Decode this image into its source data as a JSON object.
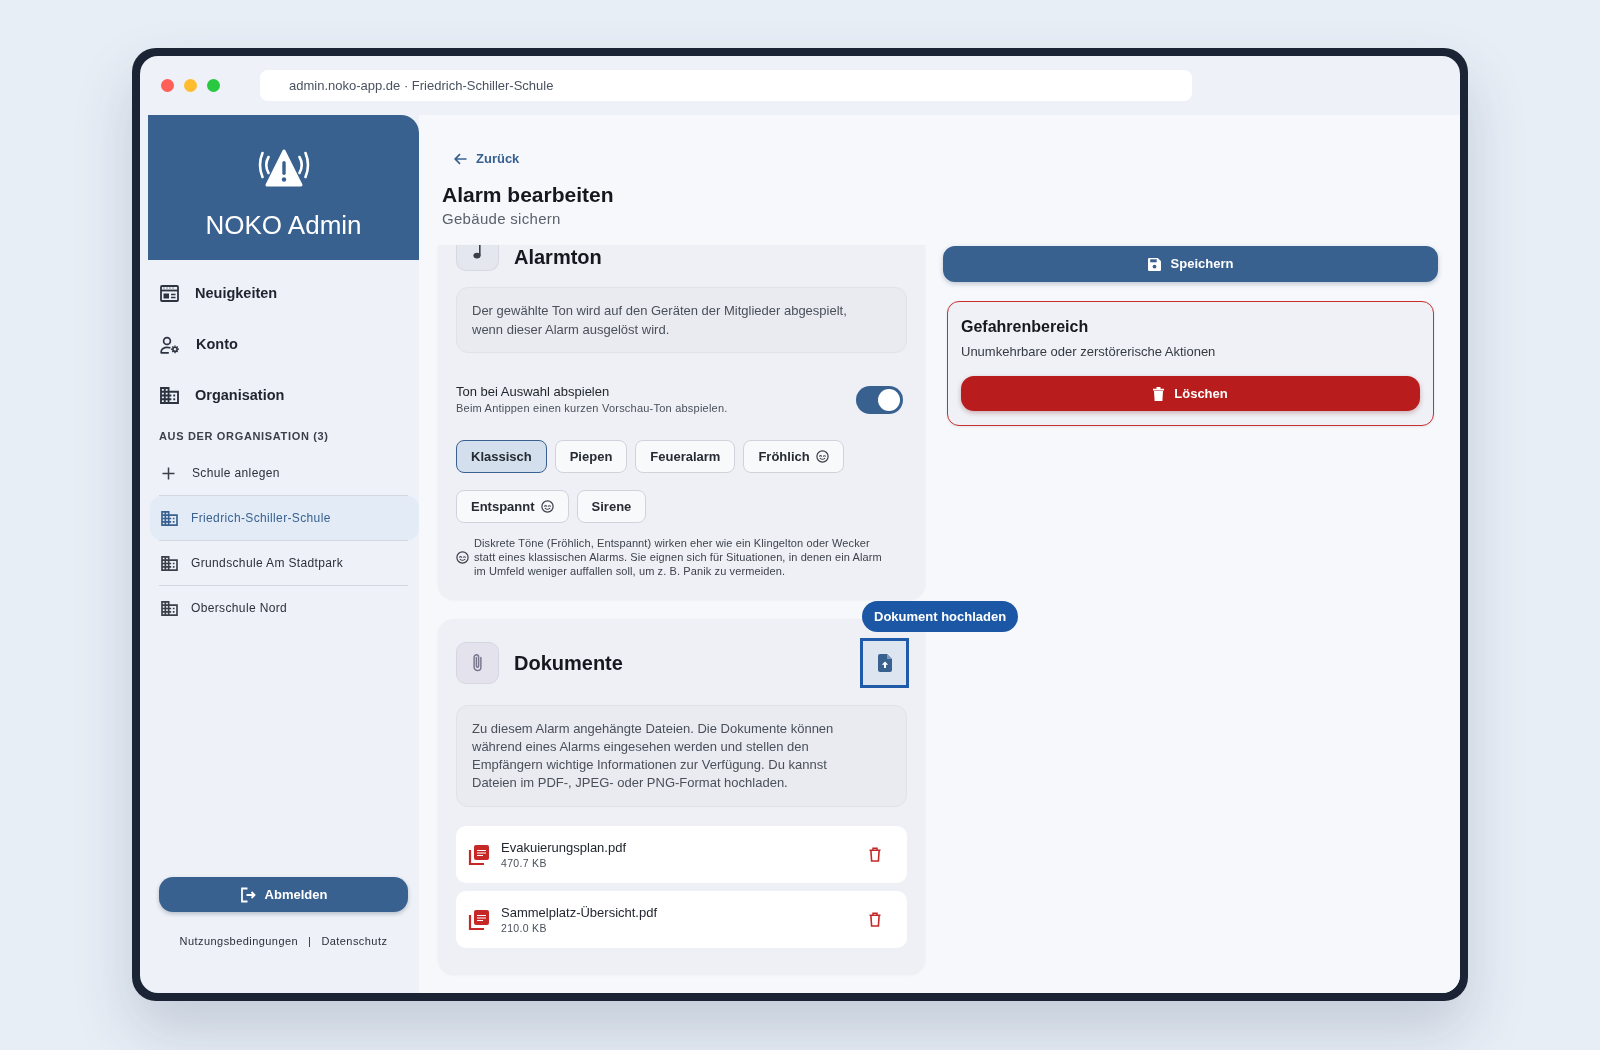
{
  "browser": {
    "address": "admin.noko-app.de · Friedrich-Schiller-Schule"
  },
  "sidebar": {
    "title": "NOKO Admin",
    "nav": [
      {
        "label": "Neuigkeiten"
      },
      {
        "label": "Konto"
      },
      {
        "label": "Organisation"
      }
    ],
    "section_label": "AUS DER ORGANISATION (3)",
    "add_item": "Schule anlegen",
    "schools": [
      {
        "label": "Friedrich-Schiller-Schule",
        "selected": true
      },
      {
        "label": "Grundschule Am Stadtpark",
        "selected": false
      },
      {
        "label": "Oberschule Nord",
        "selected": false
      }
    ],
    "logout_button": "Abmelden",
    "footer": {
      "links": [
        "Nutzungsbedingungen",
        "Datenschutz"
      ],
      "separator": "|"
    }
  },
  "page": {
    "back_link": "Zurück",
    "title": "Alarm bearbeiten",
    "subtitle": "Gebäude sichern"
  },
  "sections": [
    {
      "kind": "sound",
      "title": "Alarmton",
      "description": "Der gewählte Ton wird auf den Geräten der Mitglieder abgespielt, wenn dieser Alarm ausgelöst wird.",
      "toggle": {
        "label": "Ton bei Auswahl abspielen",
        "hint": "Beim Antippen einen kurzen Vorschau-Ton abspielen.",
        "on": true
      },
      "tones": [
        {
          "label": "Klassisch",
          "selected": true,
          "discreet": false
        },
        {
          "label": "Piepen",
          "selected": false,
          "discreet": false
        },
        {
          "label": "Feueralarm",
          "selected": false,
          "discreet": false
        },
        {
          "label": "Fröhlich",
          "selected": false,
          "discreet": true
        },
        {
          "label": "Entspannt",
          "selected": false,
          "discreet": true
        },
        {
          "label": "Sirene",
          "selected": false,
          "discreet": false
        }
      ],
      "note": "Diskrete Töne (Fröhlich, Entspannt) wirken eher wie ein Klingelton oder Wecker statt eines klassischen Alarms. Sie eignen sich für Situationen, in denen ein Alarm im Umfeld weniger auffallen soll, um z. B. Panik zu vermeiden."
    },
    {
      "kind": "documents",
      "title": "Dokumente",
      "upload": {
        "tooltip": "Dokument hochladen",
        "focused": true
      },
      "description": "Zu diesem Alarm angehängte Dateien. Die Dokumente können während eines Alarms eingesehen werden und stellen den Empfängern wichtige Informationen zur Verfügung. Du kannst Dateien im PDF-, JPEG- oder PNG-Format hochladen.",
      "files": [
        {
          "name": "Evakuierungsplan.pdf",
          "size": "470.7 KB"
        },
        {
          "name": "Sammelplatz-Übersicht.pdf",
          "size": "210.0 KB"
        }
      ]
    }
  ],
  "save_button": "Speichern",
  "danger_zone": {
    "title": "Gefahrenbereich",
    "description": "Unumkehrbare oder zerstörerische Aktionen",
    "delete_button": "Löschen"
  }
}
